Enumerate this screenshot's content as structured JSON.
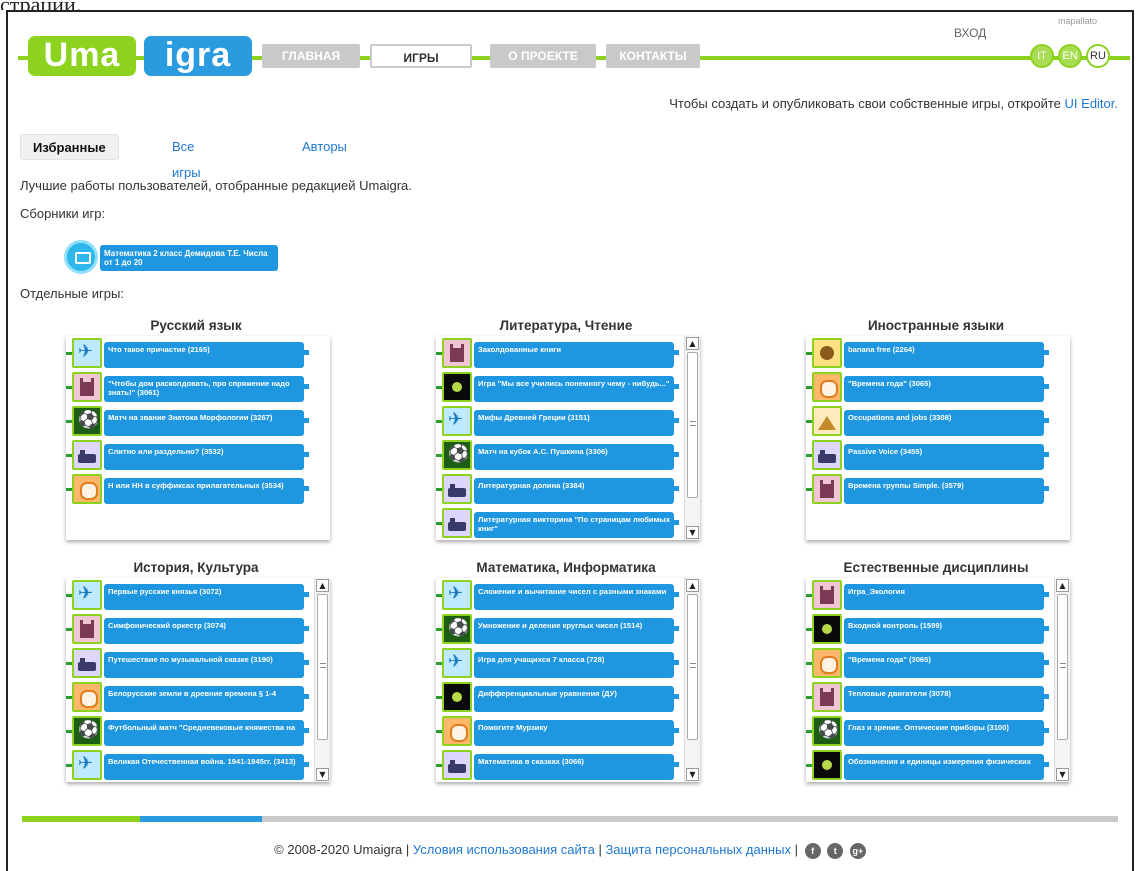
{
  "top_cut": "страции.",
  "header": {
    "logo_uma": "Uma",
    "logo_igra": "igra",
    "nav": [
      "ГЛАВНАЯ",
      "ИГРЫ",
      "О ПРОЕКТЕ",
      "КОНТАКТЫ"
    ],
    "nav_active": "ИГРЫ",
    "login": "ВХОД",
    "brand": "mapallato",
    "langs": [
      "IT",
      "EN",
      "RU"
    ],
    "lang_active": "RU"
  },
  "editor_note": {
    "text": "Чтобы создать и опубликовать свои собственные игры, откройте",
    "link": "UI Editor."
  },
  "tabs": [
    "Избранные",
    "Все игры",
    "Авторы"
  ],
  "tab_active": "Избранные",
  "intro": "Лучшие работы пользователей, отобранные редакцией Umaigra.",
  "collections_heading": "Сборники игр:",
  "collection": {
    "title": "Математика 2 класс Демидова Т.Е. Числа от 1 до 20",
    "icon": "screen-icon"
  },
  "games_heading": "Отдельные игры:",
  "categories": [
    {
      "title": "Русский язык",
      "scroll": false,
      "games": [
        {
          "title": "Что такое причастие (2165)",
          "icon": "plane"
        },
        {
          "title": "\"Чтобы дом расколдовать, про спряжение надо знать!\" (3061)",
          "icon": "castle"
        },
        {
          "title": "Матч на звание Знатока Морфологии (3267)",
          "icon": "ball"
        },
        {
          "title": "Слитно или раздельно? (3532)",
          "icon": "train"
        },
        {
          "title": "Н или НН в суффиксах прилагательных (3534)",
          "icon": "cat"
        }
      ]
    },
    {
      "title": "Литература, Чтение",
      "scroll": true,
      "games": [
        {
          "title": "Заколдованные книги",
          "icon": "castle"
        },
        {
          "title": "Игра \"Мы все учились понемногу чему - нибудь...\"",
          "icon": "dot"
        },
        {
          "title": "Мифы Древней Греции (3151)",
          "icon": "plane"
        },
        {
          "title": "Матч на кубок А.С. Пушкина (3306)",
          "icon": "ball"
        },
        {
          "title": "Литературная долина (3384)",
          "icon": "train"
        },
        {
          "title": "Литературная викторина \"По страницам любимых книг\"",
          "icon": "train"
        }
      ]
    },
    {
      "title": "Иностранные языки",
      "scroll": false,
      "games": [
        {
          "title": "banana free (2264)",
          "icon": "monkey"
        },
        {
          "title": "\"Времена года\" (3065)",
          "icon": "cat"
        },
        {
          "title": "Occupations and jobs (3308)",
          "icon": "pyramid"
        },
        {
          "title": "Passive Voice (3455)",
          "icon": "train"
        },
        {
          "title": "Времена группы Simple. (3579)",
          "icon": "castle"
        }
      ]
    },
    {
      "title": "История, Культура",
      "scroll": true,
      "games": [
        {
          "title": "Первые русские князья (3072)",
          "icon": "plane"
        },
        {
          "title": "Симфонический оркестр (3074)",
          "icon": "castle"
        },
        {
          "title": "Путешествие по музыкальной сказке (3190)",
          "icon": "train"
        },
        {
          "title": "Белорусские земли в древние времена § 1-4",
          "icon": "cat"
        },
        {
          "title": "Футбольный матч \"Средневековые княжества на",
          "icon": "ball"
        },
        {
          "title": "Великая Отечественная война. 1941-1945гг. (3413)",
          "icon": "plane"
        }
      ]
    },
    {
      "title": "Математика, Информатика",
      "scroll": true,
      "games": [
        {
          "title": "Сложение и вычитание чисел с разными знаками",
          "icon": "plane"
        },
        {
          "title": "Умножение и деление круглых чисел (1514)",
          "icon": "ball"
        },
        {
          "title": "Игра для учащихся 7 класса (728)",
          "icon": "plane"
        },
        {
          "title": "Дифференциальные уравнения (ДУ)",
          "icon": "dot"
        },
        {
          "title": "Помогите Мурзику",
          "icon": "cat"
        },
        {
          "title": "Математика в сказках (3066)",
          "icon": "train"
        }
      ]
    },
    {
      "title": "Естественные дисциплины",
      "scroll": true,
      "games": [
        {
          "title": "Игра_Экология",
          "icon": "castle"
        },
        {
          "title": "Входной контроль (1599)",
          "icon": "dot"
        },
        {
          "title": "\"Времена года\" (3065)",
          "icon": "cat"
        },
        {
          "title": "Тепловые двигатели (3078)",
          "icon": "castle"
        },
        {
          "title": "Глаз и зрение. Оптические приборы (3100)",
          "icon": "ball"
        },
        {
          "title": "Обозначения и единицы измерения физических",
          "icon": "dot"
        }
      ]
    }
  ],
  "footer": {
    "copyright": "© 2008-2020 Umaigra |",
    "link1": "Условия использования сайта",
    "sep": "|",
    "link2": "Защита персональных данных",
    "sep2": "|",
    "social": [
      "f",
      "t",
      "g+"
    ]
  }
}
